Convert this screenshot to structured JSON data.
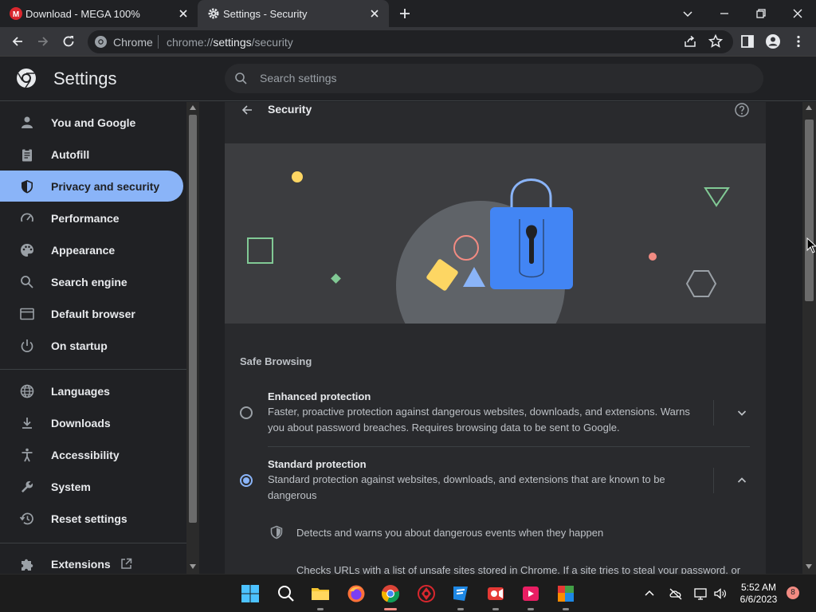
{
  "browser": {
    "tabs": [
      {
        "title": "Download - MEGA 100%",
        "favicon": "mega-icon",
        "active": false
      },
      {
        "title": "Settings - Security",
        "favicon": "gear-icon",
        "active": true
      }
    ],
    "omnibox": {
      "chip": "Chrome",
      "url_prefix": "chrome://",
      "url_main": "settings",
      "url_suffix": "/security"
    }
  },
  "header": {
    "title": "Settings",
    "search_placeholder": "Search settings"
  },
  "sidebar": {
    "items": [
      {
        "label": "You and Google",
        "icon": "person-icon",
        "active": false
      },
      {
        "label": "Autofill",
        "icon": "clipboard-icon",
        "active": false
      },
      {
        "label": "Privacy and security",
        "icon": "shield-icon",
        "active": true
      },
      {
        "label": "Performance",
        "icon": "gauge-icon",
        "active": false
      },
      {
        "label": "Appearance",
        "icon": "palette-icon",
        "active": false
      },
      {
        "label": "Search engine",
        "icon": "search-icon",
        "active": false
      },
      {
        "label": "Default browser",
        "icon": "browser-icon",
        "active": false
      },
      {
        "label": "On startup",
        "icon": "power-icon",
        "active": false
      },
      {
        "label": "Languages",
        "icon": "globe-icon",
        "active": false
      },
      {
        "label": "Downloads",
        "icon": "download-icon",
        "active": false
      },
      {
        "label": "Accessibility",
        "icon": "accessibility-icon",
        "active": false
      },
      {
        "label": "System",
        "icon": "wrench-icon",
        "active": false
      },
      {
        "label": "Reset settings",
        "icon": "history-icon",
        "active": false
      },
      {
        "label": "Extensions",
        "icon": "puzzle-icon",
        "active": false
      }
    ]
  },
  "main": {
    "title": "Security",
    "section_label": "Safe Browsing",
    "options": [
      {
        "title": "Enhanced protection",
        "description": "Faster, proactive protection against dangerous websites, downloads, and extensions. Warns you about password breaches. Requires browsing data to be sent to Google.",
        "selected": false,
        "expanded": false
      },
      {
        "title": "Standard protection",
        "description": "Standard protection against websites, downloads, and extensions that are known to be dangerous",
        "selected": true,
        "expanded": true
      }
    ],
    "standard_details": [
      "Detects and warns you about dangerous events when they happen",
      "Checks URLs with a list of unsafe sites stored in Chrome. If a site tries to steal your password, or"
    ]
  },
  "taskbar": {
    "time": "5:52 AM",
    "date": "6/6/2023",
    "notification_count": "8"
  },
  "colors": {
    "accent": "#8ab4f8",
    "background": "#202124",
    "surface": "#292a2d",
    "lock_blue": "#4285f4"
  }
}
